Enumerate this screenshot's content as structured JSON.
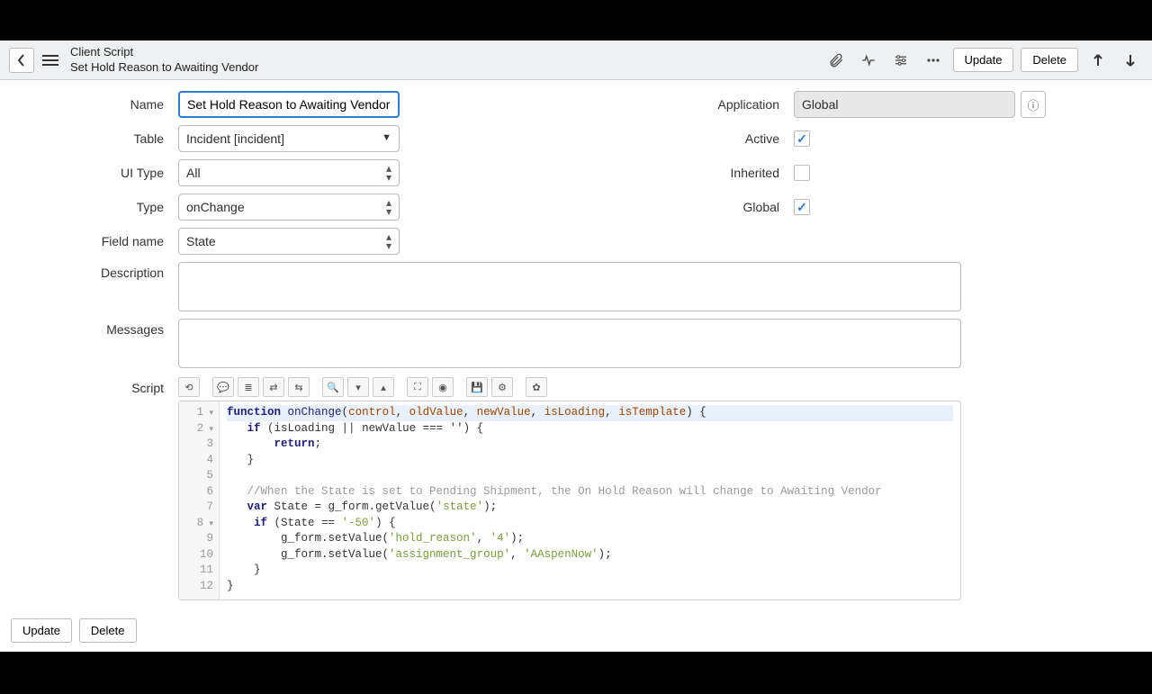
{
  "header": {
    "title1": "Client Script",
    "title2": "Set Hold Reason to Awaiting Vendor",
    "update_label": "Update",
    "delete_label": "Delete"
  },
  "form": {
    "name_label": "Name",
    "name_value": "Set Hold Reason to Awaiting Vendor",
    "table_label": "Table",
    "table_value": "Incident [incident]",
    "uitype_label": "UI Type",
    "uitype_value": "All",
    "type_label": "Type",
    "type_value": "onChange",
    "fieldname_label": "Field name",
    "fieldname_value": "State",
    "application_label": "Application",
    "application_value": "Global",
    "active_label": "Active",
    "inherited_label": "Inherited",
    "global_label": "Global",
    "description_label": "Description",
    "messages_label": "Messages",
    "script_label": "Script"
  },
  "code": {
    "lines": [
      {
        "n": "1",
        "fold": true
      },
      {
        "n": "2",
        "fold": true
      },
      {
        "n": "3"
      },
      {
        "n": "4"
      },
      {
        "n": "5"
      },
      {
        "n": "6"
      },
      {
        "n": "7"
      },
      {
        "n": "8",
        "fold": true
      },
      {
        "n": "9"
      },
      {
        "n": "10"
      },
      {
        "n": "11"
      },
      {
        "n": "12"
      }
    ],
    "l1_kw1": "function",
    "l1_fn": "onChange",
    "l1_p1": "control",
    "l1_p2": "oldValue",
    "l1_p3": "newValue",
    "l1_p4": "isLoading",
    "l1_p5": "isTemplate",
    "l2_kw": "if",
    "l2_cond": "(isLoading || newValue === '') {",
    "l3_kw": "return",
    "l4": "}",
    "l6_cm": "//When the State is set to Pending Shipment, the On Hold Reason will change to Awaiting Vendor",
    "l7_kw": "var",
    "l7_rest": " State = g_form.getValue(",
    "l7_str": "'state'",
    "l7_end": ");",
    "l8_kw": "if",
    "l8_cond_a": " (State == ",
    "l8_str": "'-50'",
    "l8_cond_b": ") {",
    "l9_a": "g_form.setValue(",
    "l9_s1": "'hold_reason'",
    "l9_c": ", ",
    "l9_s2": "'4'",
    "l9_e": ");",
    "l10_a": "g_form.setValue(",
    "l10_s1": "'assignment_group'",
    "l10_c": ", ",
    "l10_s2": "'AAspenNow'",
    "l10_e": ");",
    "l11": "}",
    "l12": "}"
  },
  "footer": {
    "update_label": "Update",
    "delete_label": "Delete"
  }
}
